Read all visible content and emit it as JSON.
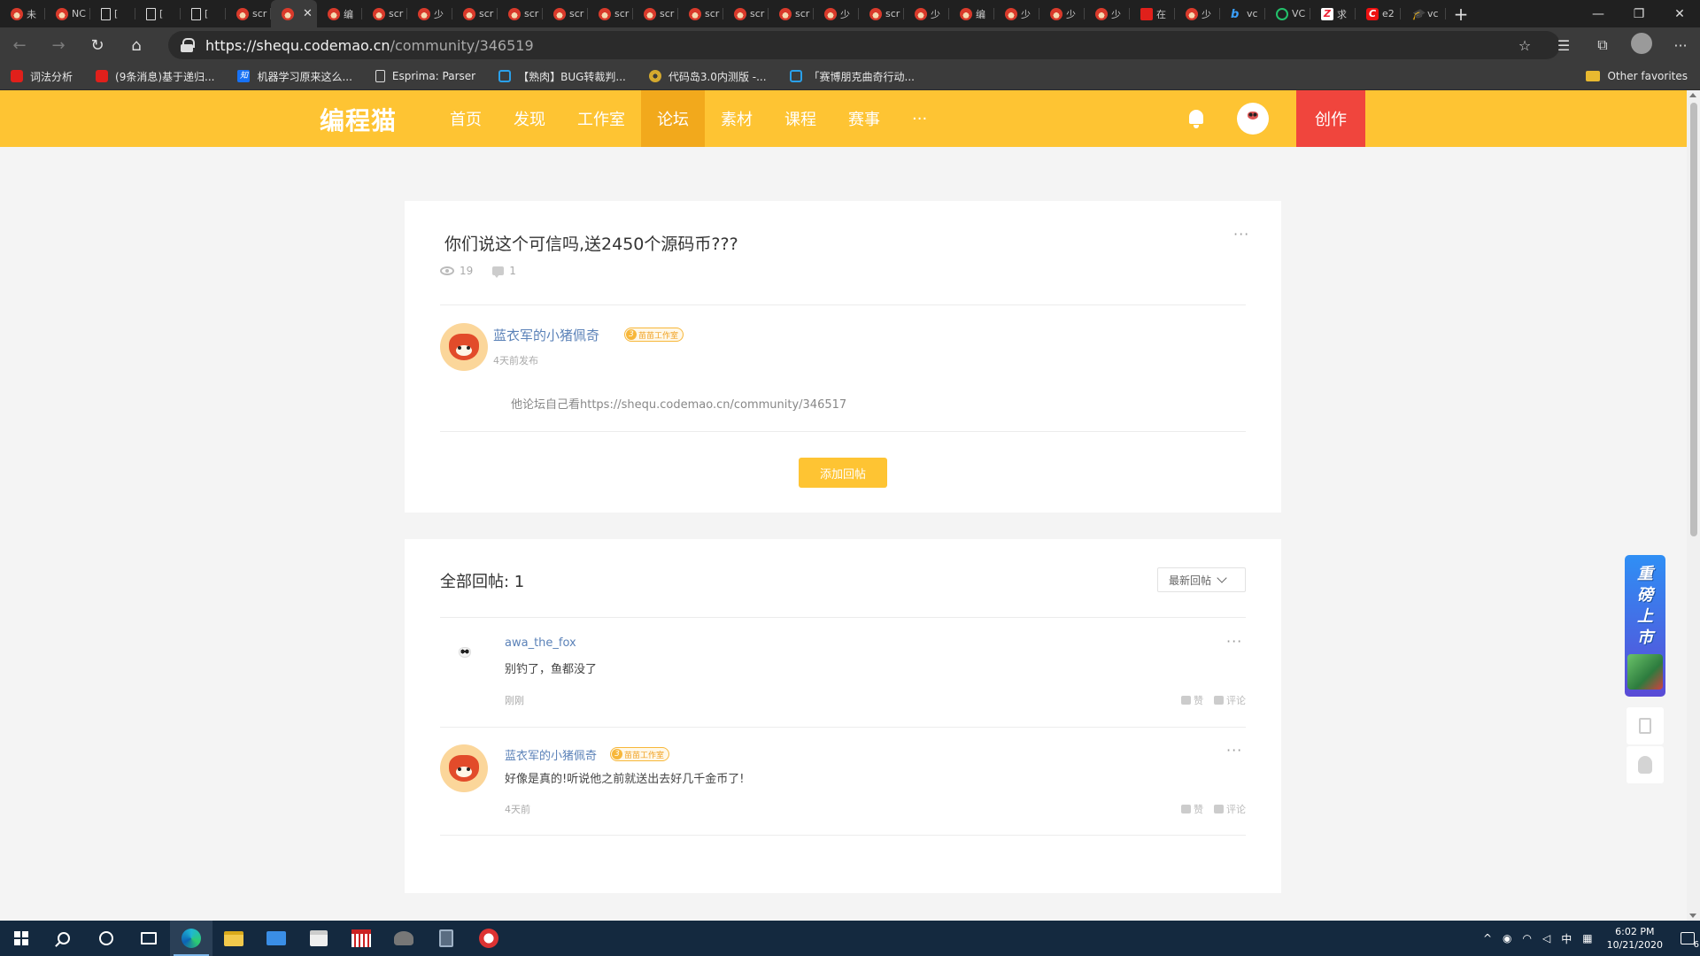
{
  "browser": {
    "tabs": [
      {
        "icon": "cat",
        "label": "未"
      },
      {
        "icon": "cat",
        "label": "NC"
      },
      {
        "icon": "doc",
        "label": "["
      },
      {
        "icon": "doc",
        "label": "["
      },
      {
        "icon": "doc",
        "label": "["
      },
      {
        "icon": "cat",
        "label": "scr"
      },
      {
        "icon": "cat",
        "label": "",
        "active": true
      },
      {
        "icon": "cat",
        "label": "编"
      },
      {
        "icon": "cat",
        "label": "scr"
      },
      {
        "icon": "cat",
        "label": "少"
      },
      {
        "icon": "cat",
        "label": "scr"
      },
      {
        "icon": "cat",
        "label": "scr"
      },
      {
        "icon": "cat",
        "label": "scr"
      },
      {
        "icon": "cat",
        "label": "scr"
      },
      {
        "icon": "cat",
        "label": "scr"
      },
      {
        "icon": "cat",
        "label": "scr"
      },
      {
        "icon": "cat",
        "label": "scr"
      },
      {
        "icon": "cat",
        "label": "scr"
      },
      {
        "icon": "cat",
        "label": "少"
      },
      {
        "icon": "cat",
        "label": "scr"
      },
      {
        "icon": "cat",
        "label": "少"
      },
      {
        "icon": "cat",
        "label": "编"
      },
      {
        "icon": "cat",
        "label": "少"
      },
      {
        "icon": "cat",
        "label": "少"
      },
      {
        "icon": "cat",
        "label": "少"
      },
      {
        "icon": "red",
        "label": "在"
      },
      {
        "icon": "cat",
        "label": "少"
      },
      {
        "icon": "bing",
        "label": "vc"
      },
      {
        "icon": "green",
        "label": "VC"
      },
      {
        "icon": "z",
        "label": "求"
      },
      {
        "icon": "c",
        "label": "e2"
      },
      {
        "icon": "hat",
        "label": "vc"
      }
    ],
    "url_host": "https://shequ.codemao.cn",
    "url_path": "/community/346519",
    "bookmarks": [
      {
        "icon": "red",
        "label": "词法分析"
      },
      {
        "icon": "red",
        "label": "(9条消息)基于递归..."
      },
      {
        "icon": "zhi",
        "label": "机器学习原来这么..."
      },
      {
        "icon": "doc",
        "label": "Esprima: Parser"
      },
      {
        "icon": "tv",
        "label": "【熟肉】BUG转裁判..."
      },
      {
        "icon": "gear",
        "label": "代码岛3.0内测版 -..."
      },
      {
        "icon": "tv",
        "label": "「赛博朋克曲奇行动..."
      }
    ],
    "other_favorites": "Other favorites"
  },
  "site": {
    "logo": "编程猫",
    "nav": [
      {
        "label": "首页"
      },
      {
        "label": "发现"
      },
      {
        "label": "工作室"
      },
      {
        "label": "论坛",
        "active": true
      },
      {
        "label": "素材"
      },
      {
        "label": "课程"
      },
      {
        "label": "赛事"
      },
      {
        "label": "···"
      }
    ],
    "create_label": "创作"
  },
  "post": {
    "title": "你们说这个可信吗,送2450个源码币???",
    "views": "19",
    "comments": "1",
    "author": "蓝衣军的小猪佩奇",
    "badge_level": "3",
    "badge_text": "苗苗工作室",
    "time": "4天前发布",
    "body": "他论坛自己看https://shequ.codemao.cn/community/346517",
    "reply_button": "添加回帖",
    "more": "···"
  },
  "replies": {
    "heading": "全部回帖: 1",
    "sort_label": "最新回帖",
    "items": [
      {
        "author": "awa_the_fox",
        "avatar": "panda",
        "text": "别钓了，鱼都没了",
        "time": "刚刚",
        "like": "赞",
        "comment": "评论",
        "more": "···"
      },
      {
        "author": "蓝衣军的小猪佩奇",
        "avatar": "cat",
        "badge_level": "3",
        "badge_text": "苗苗工作室",
        "text": "好像是真的!听说他之前就送出去好几千金币了!",
        "time": "4天前",
        "like": "赞",
        "comment": "评论",
        "more": "···"
      }
    ]
  },
  "promo": {
    "lines": [
      "重",
      "磅",
      "上",
      "市"
    ]
  },
  "taskbar": {
    "tray_lang": "中",
    "time": "6:02 PM",
    "date": "10/21/2020",
    "notifications": "6"
  }
}
